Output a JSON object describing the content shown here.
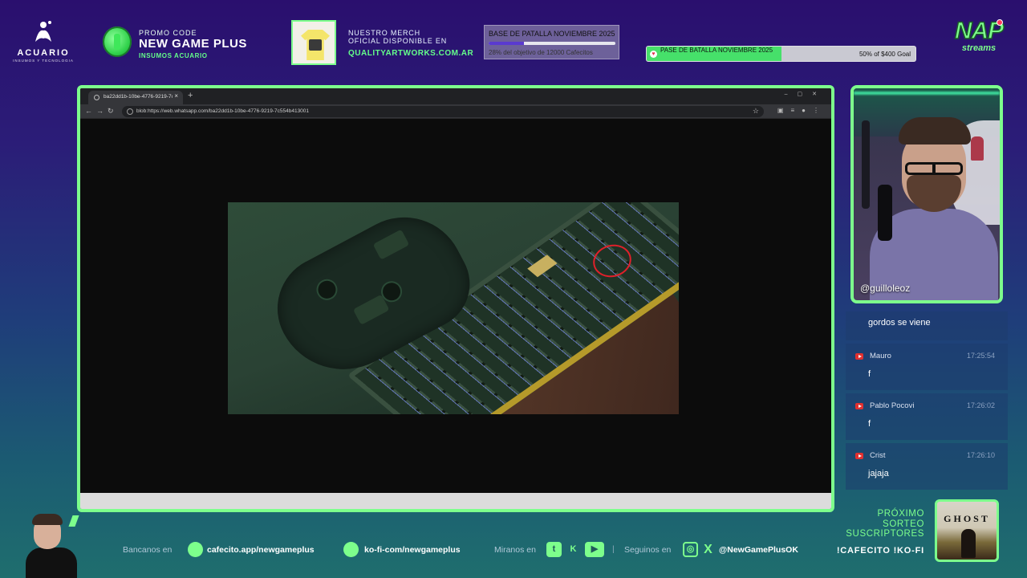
{
  "colors": {
    "accent": "#7dff8c",
    "background_top": "#2a0f6e",
    "background_bottom": "#1f6e6e",
    "goal_fill": "#46e06a",
    "alert_red": "#e0202a"
  },
  "sponsor": {
    "brand": "ACUARIO",
    "tagline": "INSUMOS Y TECNOLOGIA",
    "icon": "aquarius-logo-icon"
  },
  "promo": {
    "label": "PROMO CODE",
    "code": "NEW GAME PLUS",
    "sponsor": "INSUMOS ACUARIO",
    "icon": "coin-icon"
  },
  "merch": {
    "line1": "NUESTRO MERCH",
    "line2": "OFICIAL DISPONIBLE EN",
    "url": "QUALITYARTWORKS.COM.AR",
    "icon": "tshirt-icon"
  },
  "goal_battle_pass_1": {
    "title": "BASE DE PATALLA NOVIEMBRE 2025",
    "status": "28% del objetivo de 12000 Cafecitos",
    "progress": 0.28
  },
  "goal_battle_pass_2": {
    "title": "PASE DE BATALLA NOVIEMBRE 2025",
    "status": "50% of $400 Goal",
    "progress": 0.5,
    "icon": "heart-icon"
  },
  "channel_logo": {
    "name": "NAP",
    "sub": "streams"
  },
  "browser": {
    "tab_title": "ba22dd1b-10be-4776-9219-7c",
    "new_tab": "+",
    "url": "blob:https://web.whatsapp.com/ba22dd1b-10be-4776-9219-7c554b413001",
    "window_controls": [
      "–",
      "▢",
      "✕"
    ],
    "media_description_icon": "gaming-desk-photo"
  },
  "webcam": {
    "handle": "@guilloleoz"
  },
  "chat": {
    "top_message": "gordos se viene",
    "messages": [
      {
        "user": "Mauro",
        "time": "17:25:54",
        "text": "f",
        "platform": "youtube-icon"
      },
      {
        "user": "Pablo Pocovi",
        "time": "17:26:02",
        "text": "f",
        "platform": "youtube-icon"
      },
      {
        "user": "Crist",
        "time": "17:26:10",
        "text": "jajaja",
        "platform": "youtube-icon"
      }
    ]
  },
  "footer": {
    "bancanos_label": "Bancanos en",
    "cafecito": "cafecito.app/newgameplus",
    "kofi": "ko-fi-com/newgameplus",
    "miranos_label": "Miranos en",
    "separator": "|",
    "seguinos_label": "Seguinos en",
    "social_handle": "@NewGamePlusOK"
  },
  "sorteo": {
    "line1": "PRÓXIMO",
    "line2": "SORTEO",
    "line3": "SUSCRIPTORES",
    "commands": "!CAFECITO  !KO-FI",
    "prize_title": "GHOST"
  }
}
